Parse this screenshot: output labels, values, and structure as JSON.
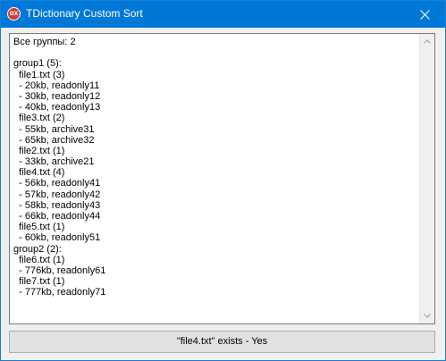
{
  "window": {
    "title": "TDictionary Custom Sort",
    "icon_text": "DX"
  },
  "memo": {
    "lines": [
      "Все группы: 2",
      "",
      "group1 (5):",
      "  file1.txt (3)",
      "  - 20kb, readonly11",
      "  - 30kb, readonly12",
      "  - 40kb, readonly13",
      "  file3.txt (2)",
      "  - 55kb, archive31",
      "  - 65kb, archive32",
      "  file2.txt (1)",
      "  - 33kb, archive21",
      "  file4.txt (4)",
      "  - 56kb, readonly41",
      "  - 57kb, readonly42",
      "  - 58kb, readonly43",
      "  - 66kb, readonly44",
      "  file5.txt (1)",
      "  - 60kb, readonly51",
      "group2 (2):",
      "  file6.txt (1)",
      "  - 776kb, readonly61",
      "  file7.txt (1)",
      "  - 777kb, readonly71"
    ]
  },
  "status_button": {
    "label": "\"file4.txt\" exists - Yes"
  },
  "colors": {
    "titlebar": "#0078d7",
    "window_bg": "#f0f0f0",
    "button_bg": "#e1e1e1",
    "icon_red": "#d63b2f"
  },
  "icons": {
    "app": "dx-logo-icon",
    "close": "close-icon",
    "scroll_up": "scroll-up-arrow-icon",
    "scroll_down": "scroll-down-arrow-icon"
  }
}
